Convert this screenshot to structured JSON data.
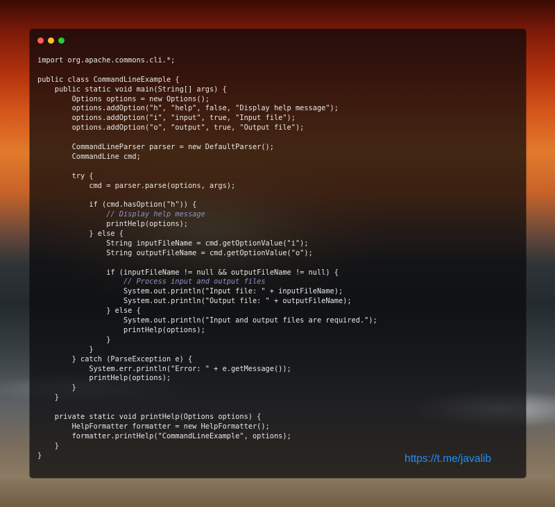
{
  "window": {
    "controls": [
      "close",
      "minimize",
      "zoom"
    ]
  },
  "code_lines": [
    "import org.apache.commons.cli.*;",
    "",
    "public class CommandLineExample {",
    "    public static void main(String[] args) {",
    "        Options options = new Options();",
    "        options.addOption(\"h\", \"help\", false, \"Display help message\");",
    "        options.addOption(\"i\", \"input\", true, \"Input file\");",
    "        options.addOption(\"o\", \"output\", true, \"Output file\");",
    "",
    "        CommandLineParser parser = new DefaultParser();",
    "        CommandLine cmd;",
    "",
    "        try {",
    "            cmd = parser.parse(options, args);",
    "",
    "            if (cmd.hasOption(\"h\")) {",
    "                // Display help message",
    "                printHelp(options);",
    "            } else {",
    "                String inputFileName = cmd.getOptionValue(\"i\");",
    "                String outputFileName = cmd.getOptionValue(\"o\");",
    "",
    "                if (inputFileName != null && outputFileName != null) {",
    "                    // Process input and output files",
    "                    System.out.println(\"Input file: \" + inputFileName);",
    "                    System.out.println(\"Output file: \" + outputFileName);",
    "                } else {",
    "                    System.out.println(\"Input and output files are required.\");",
    "                    printHelp(options);",
    "                }",
    "            }",
    "        } catch (ParseException e) {",
    "            System.err.println(\"Error: \" + e.getMessage());",
    "            printHelp(options);",
    "        }",
    "    }",
    "",
    "    private static void printHelp(Options options) {",
    "        HelpFormatter formatter = new HelpFormatter();",
    "        formatter.printHelp(\"CommandLineExample\", options);",
    "    }",
    "}"
  ],
  "watermark": "https://t.me/javalib",
  "colors": {
    "close": "#ff5f56",
    "minimize": "#ffbd2e",
    "zoom": "#27c93f",
    "watermark": "#1e90ff",
    "comment": "#8a93c8",
    "class_name": "#c9d3ff"
  }
}
